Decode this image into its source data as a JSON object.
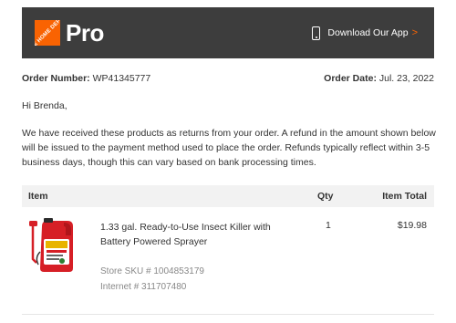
{
  "header": {
    "logo_text": "THE HOME DEPOT",
    "brand_suffix": "Pro",
    "app_link_label": "Download Our App",
    "app_link_chevron": ">",
    "brand_color": "#f96302",
    "header_bg": "#3d3d3d"
  },
  "order": {
    "number_label": "Order Number:",
    "number_value": "WP41345777",
    "date_label": "Order Date:",
    "date_value": "Jul. 23, 2022"
  },
  "greeting": "Hi Brenda,",
  "message": "We have received these products as returns from your order. A refund in the amount shown below will be issued to the payment method used to place the order. Refunds typically reflect within 3-5 business days, though this can vary based on bank processing times.",
  "table": {
    "headers": {
      "item": "Item",
      "qty": "Qty",
      "total": "Item Total"
    },
    "rows": [
      {
        "name": "1.33 gal. Ready-to-Use Insect Killer with Battery Powered Sprayer",
        "qty": "1",
        "total": "$19.98",
        "sku": "Store SKU # 1004853179",
        "internet": "Internet # 311707480",
        "image_icon": "insect-killer-jug-image"
      }
    ]
  }
}
